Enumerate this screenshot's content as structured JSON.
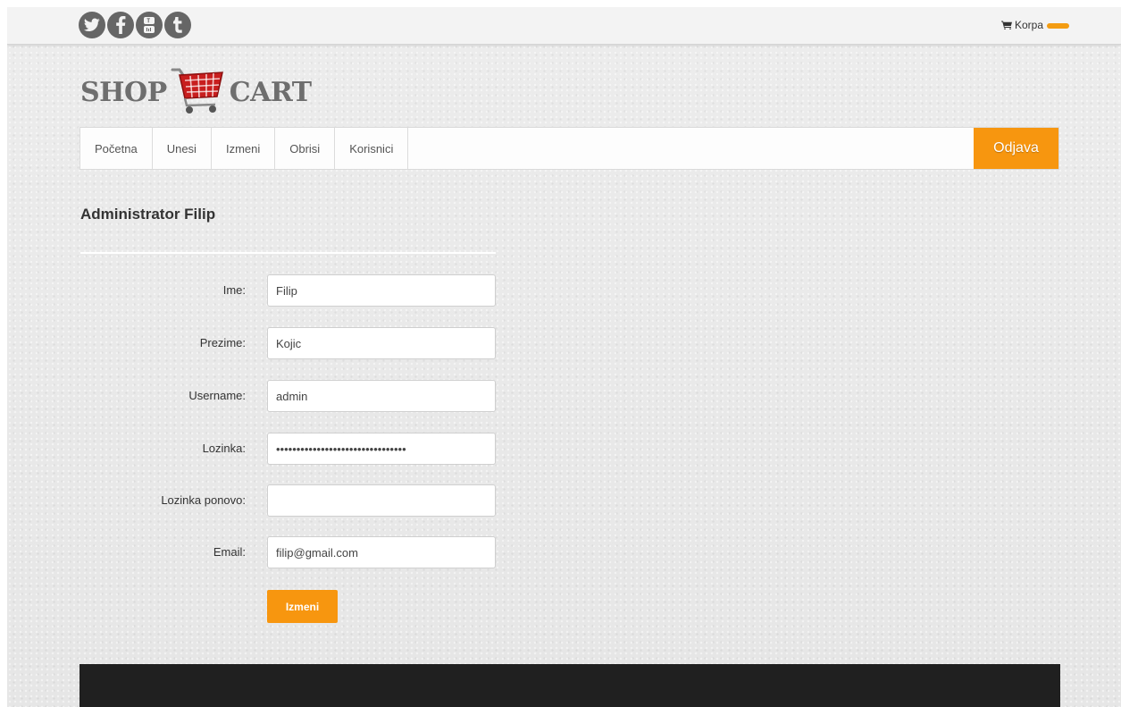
{
  "topbar": {
    "social_icons": [
      "twitter-icon",
      "facebook-icon",
      "youtube-icon",
      "tumblr-icon"
    ],
    "cart_label": "Korpa",
    "cart_icon": "cart-icon",
    "accent_color": "#f7960f"
  },
  "logo": {
    "left_text": "SHOP",
    "right_text": "CART"
  },
  "nav": {
    "items": [
      {
        "label": "Početna"
      },
      {
        "label": "Unesi"
      },
      {
        "label": "Izmeni"
      },
      {
        "label": "Obrisi"
      },
      {
        "label": "Korisnici"
      }
    ],
    "logout_label": "Odjava"
  },
  "main": {
    "title": "Administrator Filip",
    "form": {
      "first_name": {
        "label": "Ime:",
        "value": "Filip"
      },
      "last_name": {
        "label": "Prezime:",
        "value": "Kojic"
      },
      "username": {
        "label": "Username:",
        "value": "admin"
      },
      "password": {
        "label": "Lozinka:",
        "value": "filipkojicfilipkojicfilipkojic12"
      },
      "password_repeat": {
        "label": "Lozinka ponovo:",
        "value": ""
      },
      "email": {
        "label": "Email:",
        "value": "filip@gmail.com"
      },
      "submit_label": "Izmeni"
    }
  }
}
